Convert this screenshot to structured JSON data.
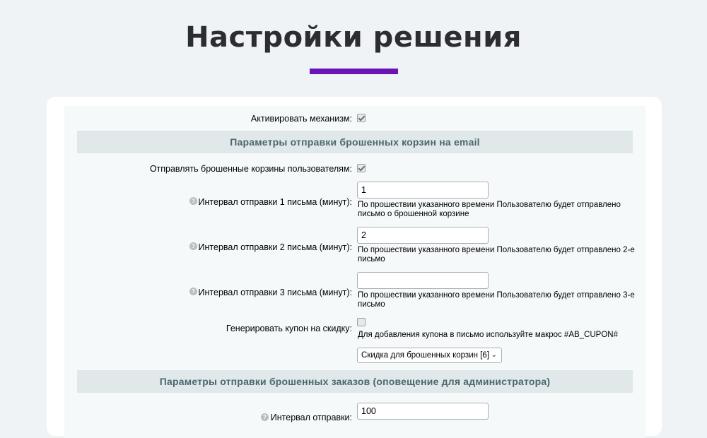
{
  "page": {
    "title": "Настройки решения"
  },
  "colors": {
    "accent": "#6a14b8",
    "section_bg": "#e0e8e9",
    "section_text": "#4b6770",
    "page_bg": "#eff3f6"
  },
  "form": {
    "activate": {
      "label": "Активировать механизм:",
      "checked": true
    },
    "section_email": {
      "title": "Параметры отправки брошенных корзин на email"
    },
    "send_to_users": {
      "label": "Отправлять брошенные корзины пользователям:",
      "checked": true
    },
    "interval1": {
      "label": "Интервал отправки 1 письма (минут):",
      "value": "1",
      "hint": "По прошествии указанного времени Пользователю будет отправлено письмо о брошенной корзине"
    },
    "interval2": {
      "label": "Интервал отправки 2 письма (минут):",
      "value": "2",
      "hint": "По прошествии указанного времени Пользователю будет отправлено 2-е письмо"
    },
    "interval3": {
      "label": "Интервал отправки 3 письма (минут):",
      "value": "",
      "hint": "По прошествии указанного времени Пользователю будет отправлено 3-е письмо"
    },
    "coupon": {
      "label": "Генерировать купон на скидку:",
      "checked": false,
      "hint": "Для добавления купона в письмо используйте макрос #AB_CUPON#",
      "select_value": "Скидка для брошенных корзин [6]"
    },
    "section_admin": {
      "title": "Параметры отправки брошенных заказов (оповещение для администратора)"
    },
    "admin_interval": {
      "label": "Интервал отправки:",
      "value": "100"
    }
  },
  "icons": {
    "help": "help-icon",
    "help_glyph": "?",
    "select_chevron": "chevron-down-icon",
    "select_chevron_glyph": "⌄"
  }
}
